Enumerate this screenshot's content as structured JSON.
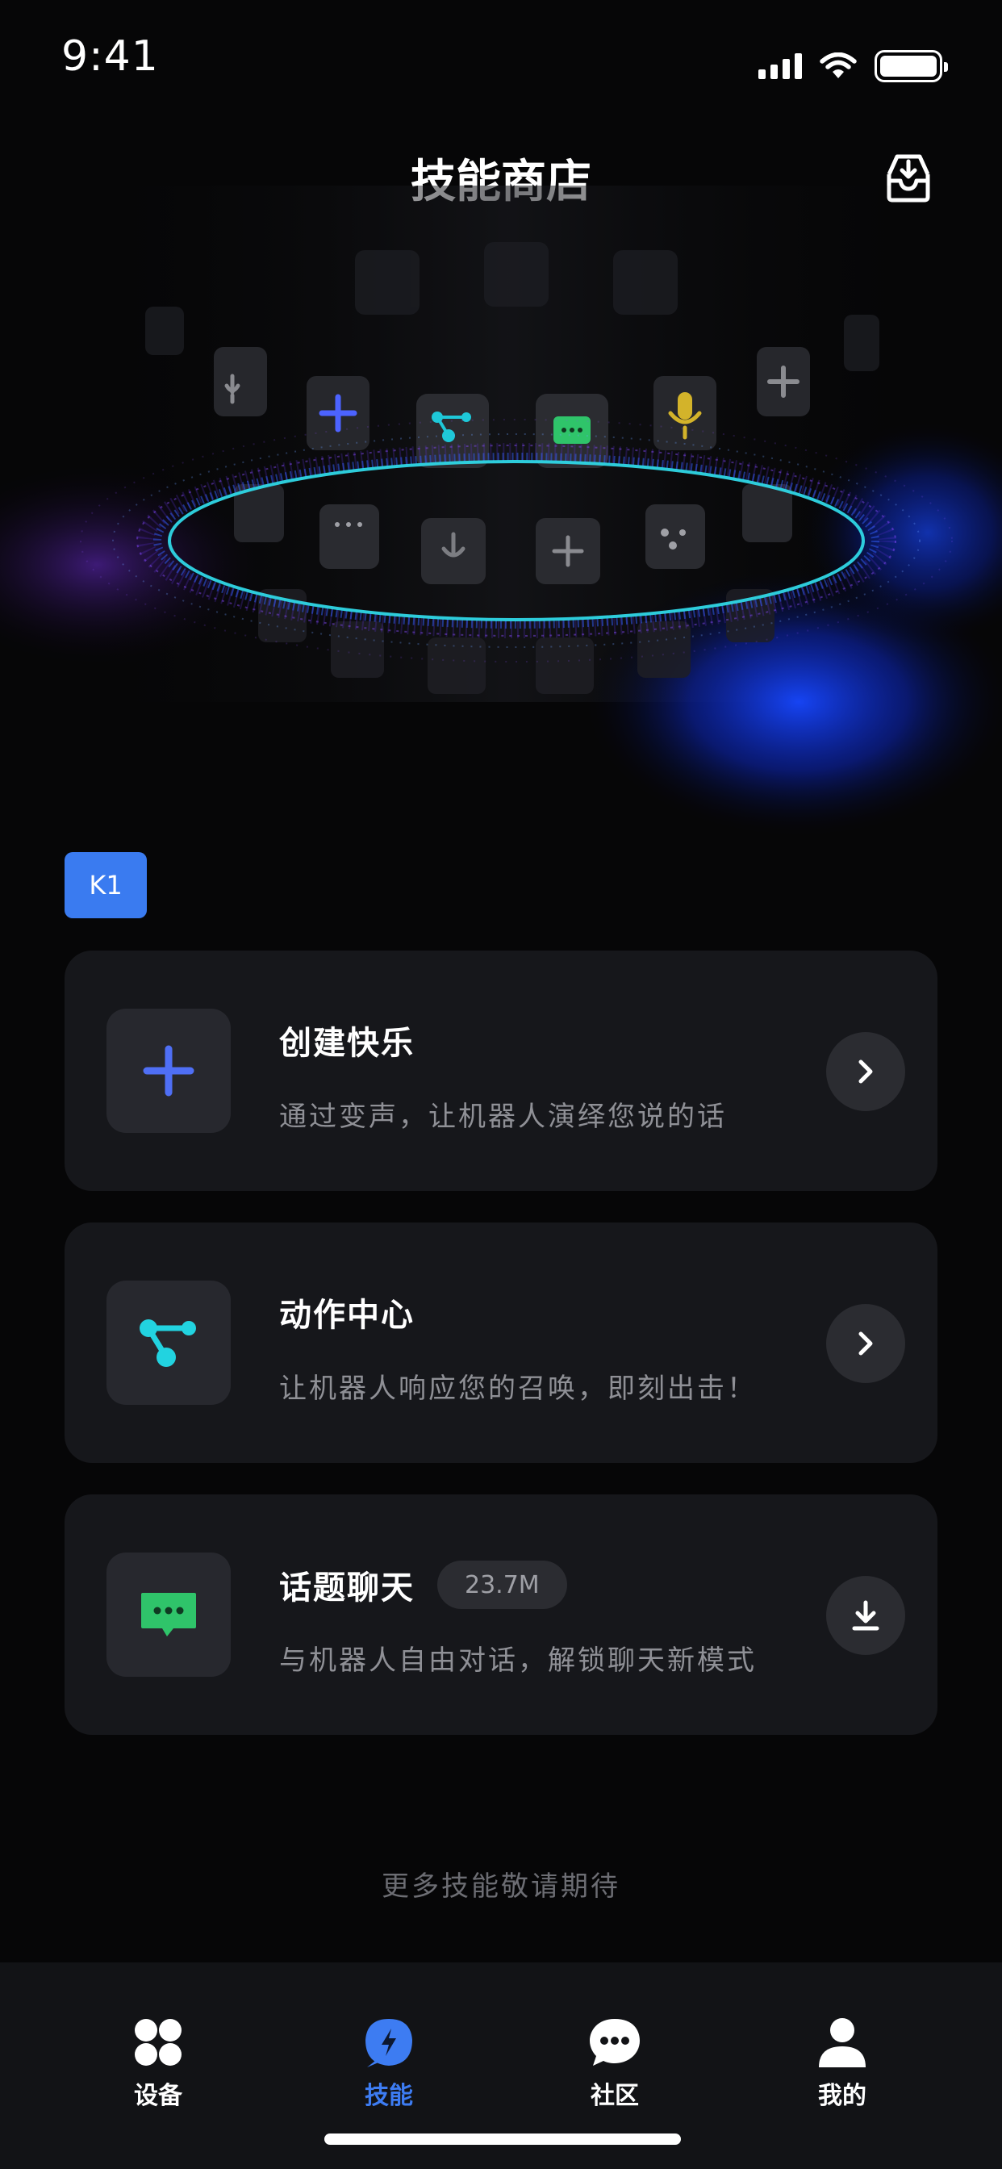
{
  "status_bar": {
    "time": "9:41"
  },
  "header": {
    "title": "技能商店",
    "inbox_icon": "inbox-download-icon"
  },
  "badge": {
    "label": "K1",
    "color": "#3a7bf0"
  },
  "cards": [
    {
      "title": "创建快乐",
      "description": "通过变声，让机器人演绎您说的话",
      "icon": "plus-icon",
      "action": "chevron-right-icon",
      "accent": "#4f6ff5"
    },
    {
      "title": "动作中心",
      "description": "让机器人响应您的召唤，即刻出击！",
      "icon": "action-nodes-icon",
      "action": "chevron-right-icon",
      "accent": "#22d3e0"
    },
    {
      "title": "话题聊天",
      "size": "23.7M",
      "description": "与机器人自由对话，解锁聊天新模式",
      "icon": "chat-bubble-icon",
      "action": "download-icon",
      "accent": "#2fc46a"
    }
  ],
  "footer": {
    "text": "更多技能敬请期待"
  },
  "tab_bar": {
    "active_color": "#3d7cf2",
    "tabs": [
      {
        "label": "设备",
        "icon": "devices-grid-icon",
        "active": false
      },
      {
        "label": "技能",
        "icon": "skill-bolt-icon",
        "active": true
      },
      {
        "label": "社区",
        "icon": "community-chat-icon",
        "active": false
      },
      {
        "label": "我的",
        "icon": "profile-icon",
        "active": false
      }
    ]
  }
}
